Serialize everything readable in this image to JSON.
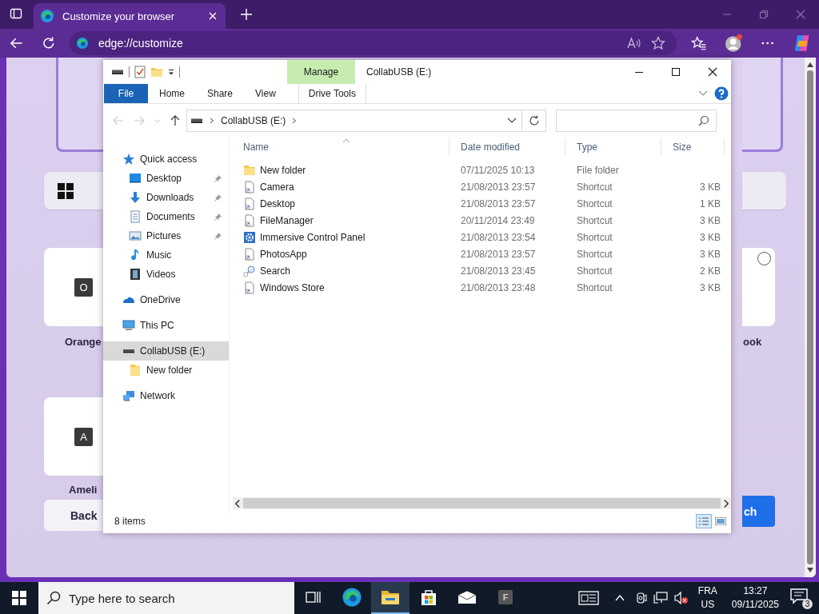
{
  "browser": {
    "tab_title": "Customize your browser",
    "address": "edge://customize"
  },
  "background": {
    "left_key_1": "O",
    "left_label_1": "Orange",
    "left_key_2": "A",
    "left_label_2": "Ameli",
    "back_button": "Back",
    "right_label": "ook",
    "right_button": "ch",
    "radio_selected": false
  },
  "explorer": {
    "title": "CollabUSB (E:)",
    "context_header": "Manage",
    "ribbon_tabs": [
      {
        "label": "File",
        "kind": "file"
      },
      {
        "label": "Home",
        "kind": "plain"
      },
      {
        "label": "Share",
        "kind": "plain"
      },
      {
        "label": "View",
        "kind": "plain"
      },
      {
        "label": "Drive Tools",
        "kind": "context"
      }
    ],
    "breadcrumb": "CollabUSB (E:)",
    "navigation": [
      {
        "label": "Quick access",
        "kind": "star",
        "selected": false,
        "children": [
          {
            "label": "Desktop",
            "kind": "desktop",
            "pinned": true,
            "selected": false
          },
          {
            "label": "Downloads",
            "kind": "download",
            "pinned": true,
            "selected": false
          },
          {
            "label": "Documents",
            "kind": "document",
            "pinned": true,
            "selected": false
          },
          {
            "label": "Pictures",
            "kind": "pictures",
            "pinned": true,
            "selected": false
          },
          {
            "label": "Music",
            "kind": "music",
            "pinned": false,
            "selected": false
          },
          {
            "label": "Videos",
            "kind": "videos",
            "pinned": false,
            "selected": false
          }
        ]
      },
      {
        "label": "OneDrive",
        "kind": "cloud",
        "selected": false
      },
      {
        "label": "This PC",
        "kind": "pc",
        "selected": false
      },
      {
        "label": "CollabUSB (E:)",
        "kind": "drive",
        "selected": true,
        "children": [
          {
            "label": "New folder",
            "kind": "folder",
            "pinned": false,
            "selected": false
          }
        ]
      },
      {
        "label": "Network",
        "kind": "network",
        "selected": false
      }
    ],
    "columns": [
      "Name",
      "Date modified",
      "Type",
      "Size"
    ],
    "rows": [
      {
        "kind": "folder",
        "name": "New folder",
        "date": "07/11/2025 10:13",
        "type": "File folder"
      },
      {
        "kind": "shortcut",
        "name": "Camera",
        "date": "21/08/2013 23:57",
        "type": "Shortcut",
        "size": "3 KB"
      },
      {
        "kind": "shortcut",
        "name": "Desktop",
        "date": "21/08/2013 23:57",
        "type": "Shortcut",
        "size": "1 KB"
      },
      {
        "kind": "shortcut",
        "name": "FileManager",
        "date": "20/11/2014 23:49",
        "type": "Shortcut",
        "size": "3 KB"
      },
      {
        "kind": "gear",
        "name": "Immersive Control Panel",
        "date": "21/08/2013 23:54",
        "type": "Shortcut",
        "size": "3 KB"
      },
      {
        "kind": "shortcut",
        "name": "PhotosApp",
        "date": "21/08/2013 23:57",
        "type": "Shortcut",
        "size": "3 KB"
      },
      {
        "kind": "search",
        "name": "Search",
        "date": "21/08/2013 23:45",
        "type": "Shortcut",
        "size": "2 KB"
      },
      {
        "kind": "shortcut",
        "name": "Windows Store",
        "date": "21/08/2013 23:48",
        "type": "Shortcut",
        "size": "3 KB"
      }
    ],
    "status": "8 items"
  },
  "taskbar": {
    "search_placeholder": "Type here to search",
    "apps": [
      {
        "kind": "task-view",
        "selected": false
      },
      {
        "kind": "edge",
        "selected": false
      },
      {
        "kind": "explorer",
        "selected": true
      },
      {
        "kind": "store",
        "selected": false
      },
      {
        "kind": "mail",
        "selected": false
      },
      {
        "kind": "letter",
        "label": "F",
        "selected": false
      }
    ],
    "language": "FRA",
    "layout": "US",
    "time": "13:27",
    "date": "09/11/2025",
    "notifications": "3"
  }
}
